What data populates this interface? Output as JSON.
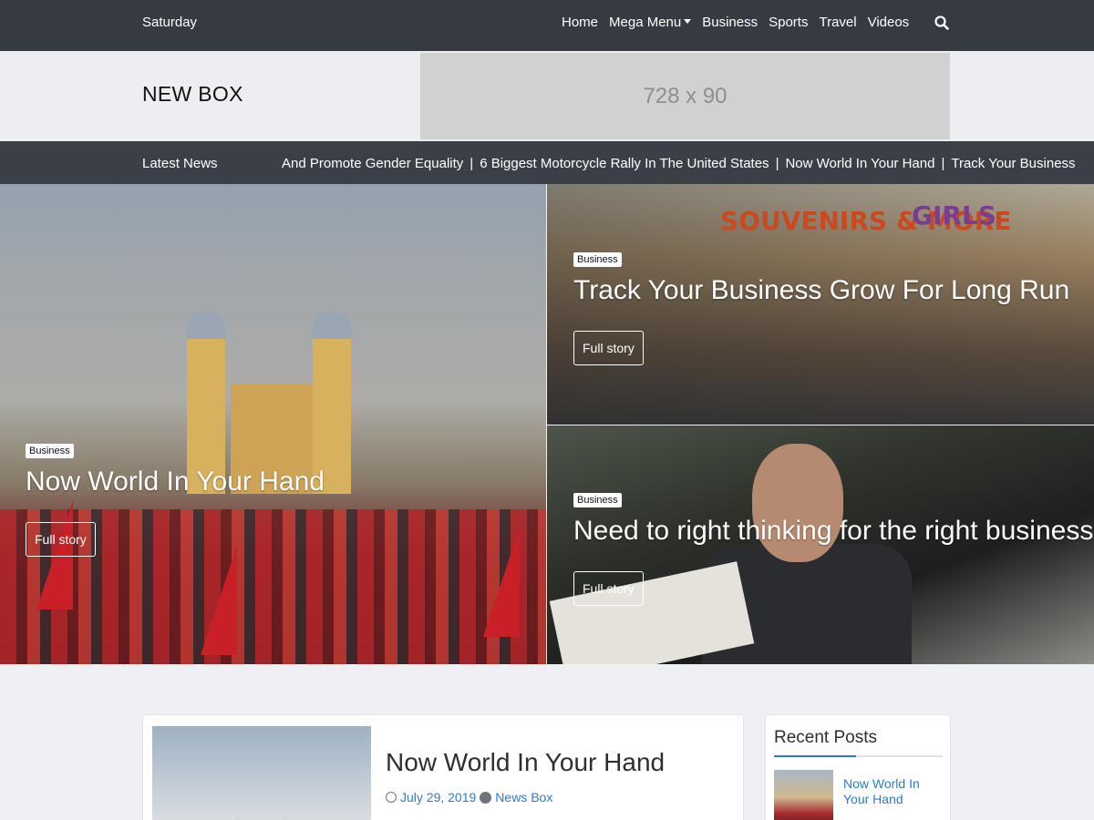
{
  "header": {
    "day": "Saturday",
    "nav": [
      {
        "label": "Home"
      },
      {
        "label": "Mega Menu",
        "has_dropdown": true
      },
      {
        "label": "Business"
      },
      {
        "label": "Sports"
      },
      {
        "label": "Travel"
      },
      {
        "label": "Videos"
      }
    ],
    "search_icon": "search-icon"
  },
  "brand": {
    "name": "NEW BOX",
    "ad_placeholder": "728 x 90"
  },
  "ticker": {
    "label": "Latest News",
    "items": [
      "And Promote Gender Equality",
      "6 Biggest Motorcycle Rally In The United States",
      "Now World In Your Hand",
      "Track Your Business"
    ],
    "separator": "|"
  },
  "hero": {
    "main": {
      "category": "Business",
      "title": "Now World In Your Hand",
      "button": "Full story"
    },
    "top": {
      "category": "Business",
      "title": "Track Your Business Grow For Long Run",
      "button": "Full story",
      "sign_left": "SOUVENIRS & MORE",
      "sign_right": "GIRLS"
    },
    "bottom": {
      "category": "Business",
      "title": "Need to right thinking for the right business",
      "button": "Full story"
    }
  },
  "featured_post": {
    "title": "Now World In Your Hand",
    "date": "July 29, 2019",
    "author": "News Box"
  },
  "sidebar": {
    "heading": "Recent Posts",
    "items": [
      {
        "title": "Now World In Your Hand"
      }
    ]
  },
  "colors": {
    "topbar": "#363b43",
    "ticker": "#3b3f47",
    "link": "#2a7bd6",
    "page_bg": "#eef0f3"
  }
}
